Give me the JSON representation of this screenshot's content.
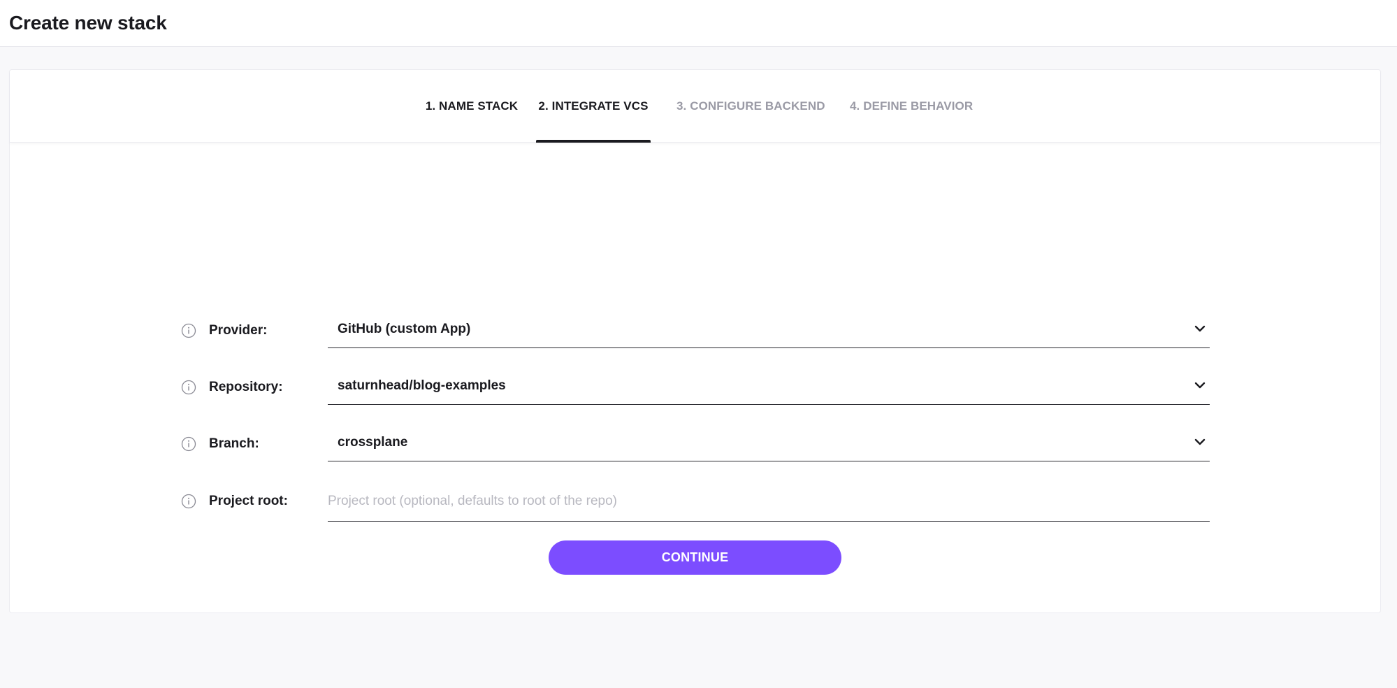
{
  "header": {
    "title": "Create new stack"
  },
  "steps": [
    {
      "label": "1. NAME STACK",
      "state": "done"
    },
    {
      "label": "2. INTEGRATE VCS",
      "state": "active"
    },
    {
      "label": "3. CONFIGURE BACKEND",
      "state": "pending"
    },
    {
      "label": "4. DEFINE BEHAVIOR",
      "state": "pending"
    }
  ],
  "form": {
    "provider": {
      "label": "Provider:",
      "value": "GitHub (custom App)"
    },
    "repository": {
      "label": "Repository:",
      "value": "saturnhead/blog-examples"
    },
    "branch": {
      "label": "Branch:",
      "value": "crossplane"
    },
    "project_root": {
      "label": "Project root:",
      "value": "",
      "placeholder": "Project root (optional, defaults to root of the repo)"
    }
  },
  "actions": {
    "continue_label": "CONTINUE"
  },
  "colors": {
    "accent": "#7c4dff",
    "active_step": "#1a1a1f",
    "pending_step": "#9a9aa5"
  },
  "icons": {
    "info": "info-circle-icon",
    "dropdown": "chevron-down-icon"
  }
}
